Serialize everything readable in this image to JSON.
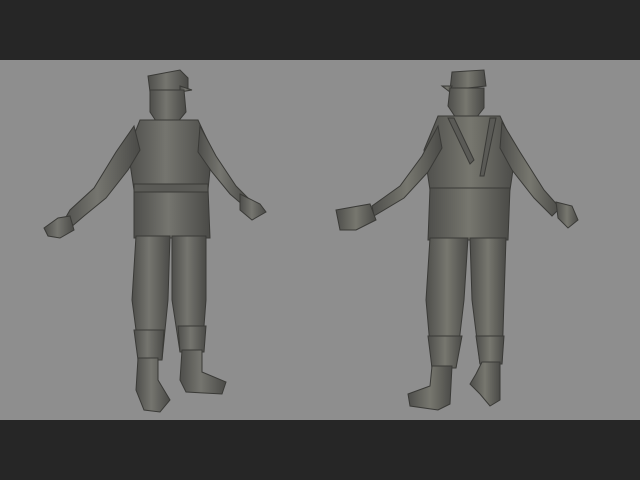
{
  "scene": {
    "subject": "",
    "colors": {
      "background": "#8e8e8e",
      "letterbox": "#262626",
      "model": "#6a6a66",
      "model_highlight": "#8a8a86",
      "model_shadow": "#3f3f3c"
    }
  }
}
